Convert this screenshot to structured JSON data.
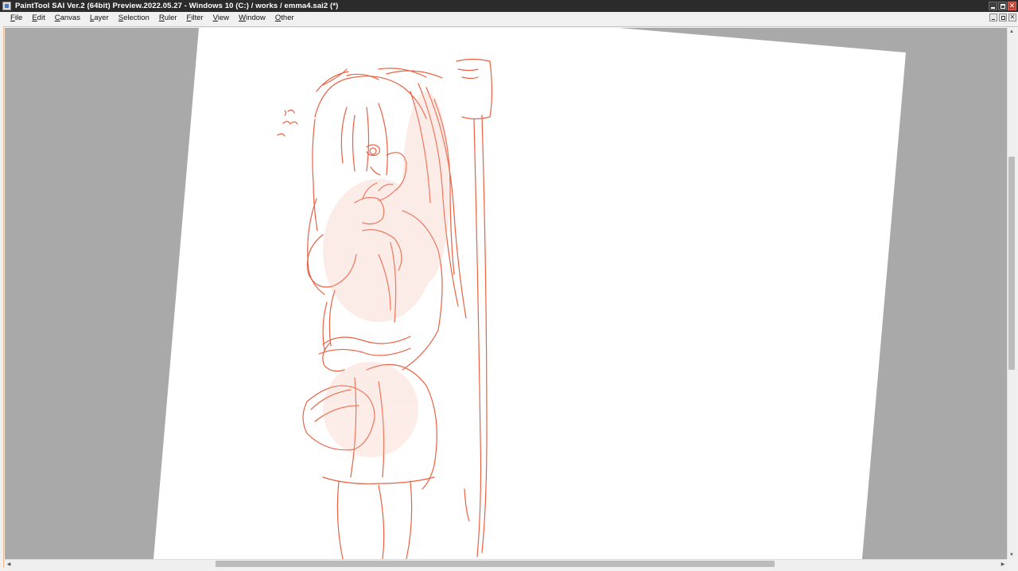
{
  "window": {
    "title": "PaintTool SAI Ver.2 (64bit) Preview.2022.05.27 - Windows 10 (C:) / works / emma4.sai2 (*)",
    "app_icon": "painttool-sai-icon",
    "controls": [
      "minimize-icon",
      "maximize-icon",
      "close-icon"
    ]
  },
  "menu": {
    "items": [
      "File",
      "Edit",
      "Canvas",
      "Layer",
      "Selection",
      "Ruler",
      "Filter",
      "View",
      "Window",
      "Other"
    ]
  },
  "canvas": {
    "document": "emma4.sai2",
    "background_color": "#a9a9a9",
    "paper_color": "#ffffff",
    "stroke_color": "#e8502f",
    "view_rotated": true
  },
  "scrollbars": {
    "vertical": {
      "position": 0.24,
      "visible_fraction": 0.4
    },
    "horizontal": {
      "position": 0.21,
      "visible_fraction": 0.56
    }
  }
}
